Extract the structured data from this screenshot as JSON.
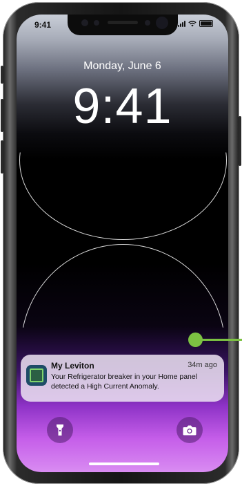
{
  "status_bar": {
    "time": "9:41"
  },
  "lock_screen": {
    "date": "Monday, June 6",
    "time": "9:41"
  },
  "notification": {
    "app_name": "My Leviton",
    "age": "34m ago",
    "message": "Your Refrigerator breaker in your Home panel detected a High Current Anomaly."
  },
  "controls": {
    "left_icon": "flashlight-icon",
    "right_icon": "camera-icon"
  },
  "colors": {
    "callout": "#7cc242",
    "accent_purple": "#c55ee9"
  }
}
